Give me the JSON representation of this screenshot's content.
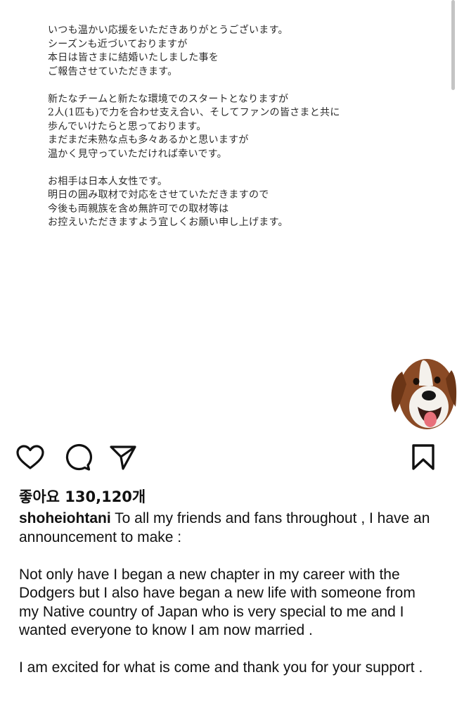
{
  "letter": {
    "paragraphs": [
      [
        "いつも温かい応援をいただきありがとうございます。",
        "シーズンも近づいておりますが",
        "本日は皆さまに結婚いたしました事を",
        "ご報告させていただきます。"
      ],
      [
        "新たなチームと新たな環境でのスタートとなりますが",
        "2人(1匹も)で力を合わせ支え合い、そしてファンの皆さまと共に",
        "歩んでいけたらと思っております。",
        "まだまだ未熟な点も多々あるかと思いますが",
        "温かく見守っていただければ幸いです。"
      ],
      [
        "お相手は日本人女性です。",
        "明日の囲み取材で対応をさせていただきますので",
        "今後も両親族を含め無許可での取材等は",
        "お控えいただきますよう宜しくお願い申し上げます。"
      ]
    ]
  },
  "post": {
    "likes_text": "좋아요 130,120개",
    "username": "shoheiohtani",
    "caption_first": " To all my friends and fans throughout , I have an announcement to make :",
    "caption_second": "Not only have I began a new chapter in my career with the Dodgers but I also have began a new life with someone from my Native country of Japan who is very special to me and I wanted everyone to know I am now married .",
    "caption_third": "I am excited for what is come and thank you for your support ."
  },
  "icons": {
    "like": "heart-icon",
    "comment": "comment-icon",
    "share": "paper-plane-icon",
    "save": "bookmark-icon"
  }
}
